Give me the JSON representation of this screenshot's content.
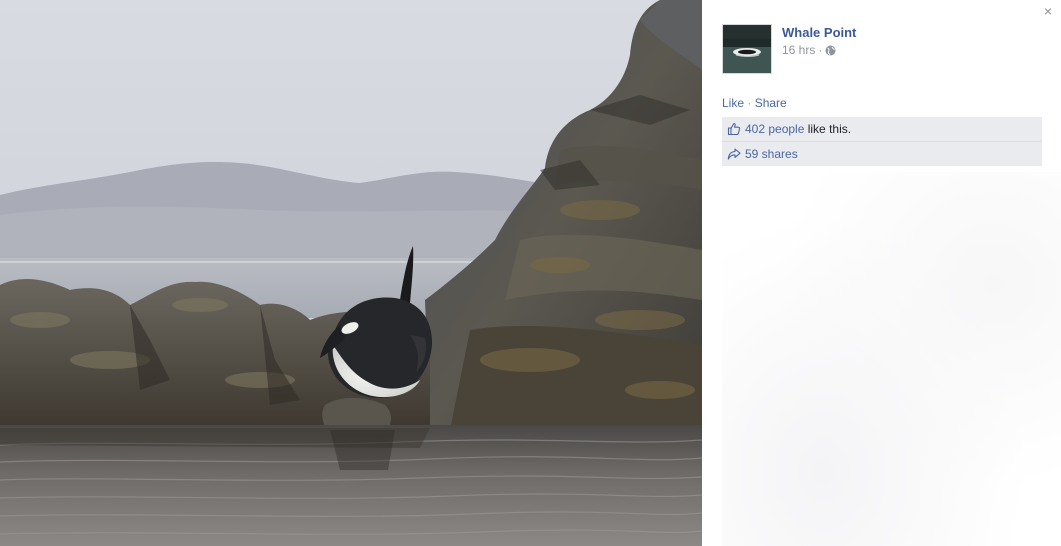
{
  "post": {
    "page_name": "Whale Point",
    "timestamp": "16 hrs",
    "separator": "·",
    "audience_icon": "globe-icon"
  },
  "actions": {
    "like_label": "Like",
    "separator": "·",
    "share_label": "Share"
  },
  "reactions": {
    "likes_count": "402 people",
    "likes_suffix": " like this.",
    "likes_icon": "thumbs-up-icon",
    "shares_text": "59 shares",
    "shares_icon": "share-arrow-icon"
  },
  "window": {
    "close_glyph": "×"
  },
  "colors": {
    "link": "#3b5998",
    "meta": "#90949c",
    "ufi_bg": "#e9ebee"
  }
}
